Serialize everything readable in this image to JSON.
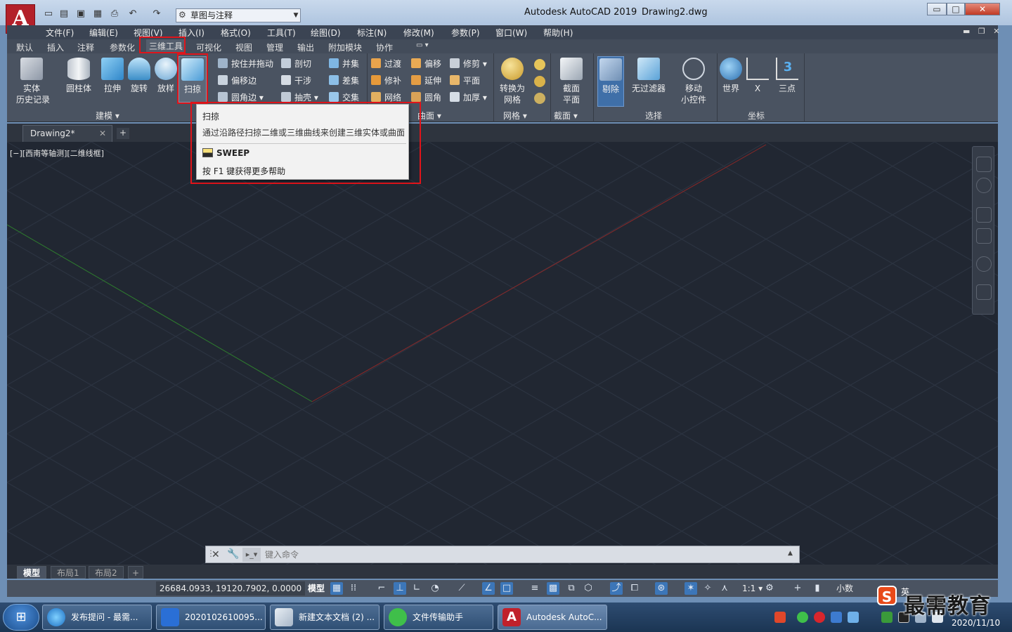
{
  "app": {
    "title": "Autodesk AutoCAD 2019",
    "filename": "Drawing2.dwg",
    "logo": "A",
    "workspace": "草图与注释"
  },
  "window_controls": {
    "minimize": "▭",
    "maximize": "□",
    "close": "✕"
  },
  "menu": [
    "文件(F)",
    "编辑(E)",
    "视图(V)",
    "插入(I)",
    "格式(O)",
    "工具(T)",
    "绘图(D)",
    "标注(N)",
    "修改(M)",
    "参数(P)",
    "窗口(W)",
    "帮助(H)"
  ],
  "ribbon_tabs": [
    "默认",
    "插入",
    "注释",
    "参数化",
    "三维工具",
    "可视化",
    "视图",
    "管理",
    "输出",
    "附加模块",
    "协作"
  ],
  "active_tab": "三维工具",
  "panels": {
    "modeling": {
      "title": "建模 ▾",
      "solid_history": "实体\n历史记录",
      "buttons": [
        "圆柱体",
        "拉伸",
        "旋转",
        "放样",
        "扫掠"
      ],
      "small": [
        "按住并拖动",
        "偏移边",
        "圆角边 ▾",
        "剖切",
        "干涉",
        "抽壳 ▾",
        "并集",
        "差集",
        "交集"
      ]
    },
    "surface": {
      "title": "曲面 ▾",
      "small": [
        "过渡",
        "修补",
        "网络",
        "偏移",
        "延伸",
        "圆角",
        "修剪 ▾",
        "平面",
        "加厚 ▾"
      ]
    },
    "mesh": {
      "title": "网格 ▾",
      "convert": "转换为\n网格"
    },
    "section": {
      "title": "截面 ▾",
      "plane": "截面\n平面"
    },
    "selection": {
      "title": "选择",
      "cull": "剔除",
      "nofilter": "无过滤器",
      "gizmo": "移动\n小控件"
    },
    "coordinates": {
      "title": "坐标",
      "world": "世界",
      "x": "X",
      "three": "三点"
    }
  },
  "doc_tab": "Drawing2*",
  "viewport_label": "[−][西南等轴测][二维线框]",
  "tooltip": {
    "title": "扫掠",
    "description": "通过沿路径扫掠二维或三维曲线来创建三维实体或曲面",
    "command": "SWEEP",
    "help": "按 F1 键获得更多帮助"
  },
  "command_line": {
    "placeholder": "键入命令"
  },
  "layout_tabs": [
    "模型",
    "布局1",
    "布局2",
    "+"
  ],
  "status": {
    "coords": "26684.0933, 19120.7902, 0.0000",
    "model": "模型",
    "scale": "1:1 ▾",
    "units": "小数"
  },
  "taskbar": {
    "tasks": [
      "发布提问 - 最需...",
      "2020102610095...",
      "新建文本文档 (2) ...",
      "文件传输助手",
      "Autodesk AutoC..."
    ],
    "time": "2020/11/10"
  },
  "watermark": {
    "text": "最需教育",
    "ime": "英"
  },
  "colors": {
    "accent_red": "#e0141a",
    "canvas": "#212732",
    "ribbon": "#4a5361"
  }
}
